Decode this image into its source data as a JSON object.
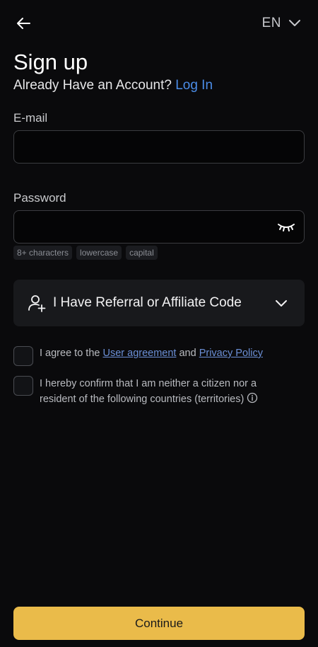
{
  "header": {
    "back_icon": "arrow-left-icon",
    "language": "EN",
    "language_icon": "chevron-down-icon"
  },
  "title": "Sign up",
  "subtitle": {
    "text": "Already Have an Account?",
    "link": "Log In"
  },
  "email": {
    "label": "E-mail",
    "value": "",
    "placeholder": ""
  },
  "password": {
    "label": "Password",
    "value": "",
    "placeholder": "",
    "toggle_icon": "eye-closed-icon",
    "hints": [
      "8+ characters",
      "lowercase",
      "capital"
    ]
  },
  "referral": {
    "icon": "add-user-icon",
    "label": "I Have Referral or Affiliate Code",
    "chevron_icon": "chevron-down-icon"
  },
  "agreement": {
    "prefix": "I agree to the ",
    "user_agreement": "User agreement",
    "middle": " and ",
    "privacy_policy": "Privacy Policy",
    "checked": false
  },
  "residency": {
    "text": "I hereby confirm that I am neither a citizen nor a resident of the following countries (territories)",
    "info_icon": "info-icon",
    "checked": false
  },
  "continue_label": "Continue",
  "colors": {
    "background": "#0a0a0c",
    "accent": "#eabb4a",
    "link": "#4b8de8"
  }
}
